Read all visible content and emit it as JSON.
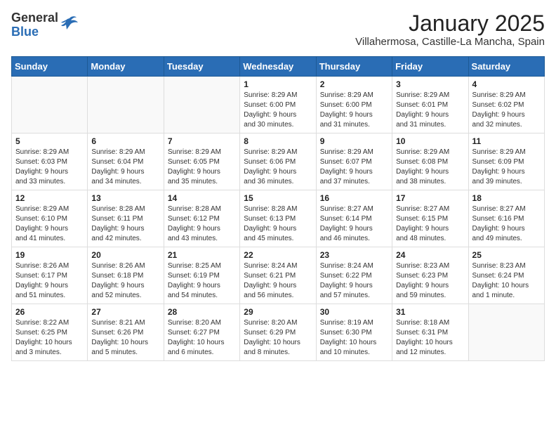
{
  "header": {
    "logo_general": "General",
    "logo_blue": "Blue",
    "month_title": "January 2025",
    "location": "Villahermosa, Castille-La Mancha, Spain"
  },
  "days_of_week": [
    "Sunday",
    "Monday",
    "Tuesday",
    "Wednesday",
    "Thursday",
    "Friday",
    "Saturday"
  ],
  "weeks": [
    [
      {
        "day": "",
        "info": ""
      },
      {
        "day": "",
        "info": ""
      },
      {
        "day": "",
        "info": ""
      },
      {
        "day": "1",
        "info": "Sunrise: 8:29 AM\nSunset: 6:00 PM\nDaylight: 9 hours\nand 30 minutes."
      },
      {
        "day": "2",
        "info": "Sunrise: 8:29 AM\nSunset: 6:00 PM\nDaylight: 9 hours\nand 31 minutes."
      },
      {
        "day": "3",
        "info": "Sunrise: 8:29 AM\nSunset: 6:01 PM\nDaylight: 9 hours\nand 31 minutes."
      },
      {
        "day": "4",
        "info": "Sunrise: 8:29 AM\nSunset: 6:02 PM\nDaylight: 9 hours\nand 32 minutes."
      }
    ],
    [
      {
        "day": "5",
        "info": "Sunrise: 8:29 AM\nSunset: 6:03 PM\nDaylight: 9 hours\nand 33 minutes."
      },
      {
        "day": "6",
        "info": "Sunrise: 8:29 AM\nSunset: 6:04 PM\nDaylight: 9 hours\nand 34 minutes."
      },
      {
        "day": "7",
        "info": "Sunrise: 8:29 AM\nSunset: 6:05 PM\nDaylight: 9 hours\nand 35 minutes."
      },
      {
        "day": "8",
        "info": "Sunrise: 8:29 AM\nSunset: 6:06 PM\nDaylight: 9 hours\nand 36 minutes."
      },
      {
        "day": "9",
        "info": "Sunrise: 8:29 AM\nSunset: 6:07 PM\nDaylight: 9 hours\nand 37 minutes."
      },
      {
        "day": "10",
        "info": "Sunrise: 8:29 AM\nSunset: 6:08 PM\nDaylight: 9 hours\nand 38 minutes."
      },
      {
        "day": "11",
        "info": "Sunrise: 8:29 AM\nSunset: 6:09 PM\nDaylight: 9 hours\nand 39 minutes."
      }
    ],
    [
      {
        "day": "12",
        "info": "Sunrise: 8:29 AM\nSunset: 6:10 PM\nDaylight: 9 hours\nand 41 minutes."
      },
      {
        "day": "13",
        "info": "Sunrise: 8:28 AM\nSunset: 6:11 PM\nDaylight: 9 hours\nand 42 minutes."
      },
      {
        "day": "14",
        "info": "Sunrise: 8:28 AM\nSunset: 6:12 PM\nDaylight: 9 hours\nand 43 minutes."
      },
      {
        "day": "15",
        "info": "Sunrise: 8:28 AM\nSunset: 6:13 PM\nDaylight: 9 hours\nand 45 minutes."
      },
      {
        "day": "16",
        "info": "Sunrise: 8:27 AM\nSunset: 6:14 PM\nDaylight: 9 hours\nand 46 minutes."
      },
      {
        "day": "17",
        "info": "Sunrise: 8:27 AM\nSunset: 6:15 PM\nDaylight: 9 hours\nand 48 minutes."
      },
      {
        "day": "18",
        "info": "Sunrise: 8:27 AM\nSunset: 6:16 PM\nDaylight: 9 hours\nand 49 minutes."
      }
    ],
    [
      {
        "day": "19",
        "info": "Sunrise: 8:26 AM\nSunset: 6:17 PM\nDaylight: 9 hours\nand 51 minutes."
      },
      {
        "day": "20",
        "info": "Sunrise: 8:26 AM\nSunset: 6:18 PM\nDaylight: 9 hours\nand 52 minutes."
      },
      {
        "day": "21",
        "info": "Sunrise: 8:25 AM\nSunset: 6:19 PM\nDaylight: 9 hours\nand 54 minutes."
      },
      {
        "day": "22",
        "info": "Sunrise: 8:24 AM\nSunset: 6:21 PM\nDaylight: 9 hours\nand 56 minutes."
      },
      {
        "day": "23",
        "info": "Sunrise: 8:24 AM\nSunset: 6:22 PM\nDaylight: 9 hours\nand 57 minutes."
      },
      {
        "day": "24",
        "info": "Sunrise: 8:23 AM\nSunset: 6:23 PM\nDaylight: 9 hours\nand 59 minutes."
      },
      {
        "day": "25",
        "info": "Sunrise: 8:23 AM\nSunset: 6:24 PM\nDaylight: 10 hours\nand 1 minute."
      }
    ],
    [
      {
        "day": "26",
        "info": "Sunrise: 8:22 AM\nSunset: 6:25 PM\nDaylight: 10 hours\nand 3 minutes."
      },
      {
        "day": "27",
        "info": "Sunrise: 8:21 AM\nSunset: 6:26 PM\nDaylight: 10 hours\nand 5 minutes."
      },
      {
        "day": "28",
        "info": "Sunrise: 8:20 AM\nSunset: 6:27 PM\nDaylight: 10 hours\nand 6 minutes."
      },
      {
        "day": "29",
        "info": "Sunrise: 8:20 AM\nSunset: 6:29 PM\nDaylight: 10 hours\nand 8 minutes."
      },
      {
        "day": "30",
        "info": "Sunrise: 8:19 AM\nSunset: 6:30 PM\nDaylight: 10 hours\nand 10 minutes."
      },
      {
        "day": "31",
        "info": "Sunrise: 8:18 AM\nSunset: 6:31 PM\nDaylight: 10 hours\nand 12 minutes."
      },
      {
        "day": "",
        "info": ""
      }
    ]
  ]
}
